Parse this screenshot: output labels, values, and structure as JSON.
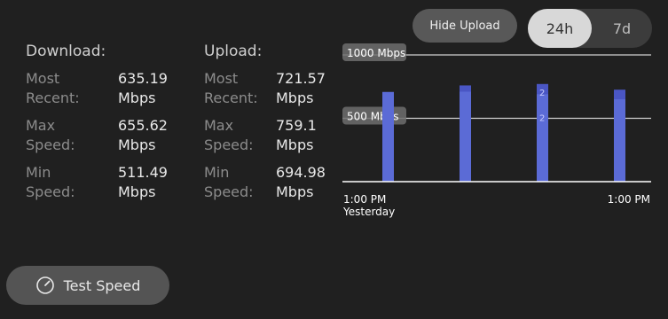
{
  "download": {
    "heading": "Download:",
    "rows": [
      {
        "label_1": "Most",
        "label_2": "Recent:",
        "value": "635.19",
        "unit": "Mbps"
      },
      {
        "label_1": "Max",
        "label_2": "Speed:",
        "value": "655.62",
        "unit": "Mbps"
      },
      {
        "label_1": "Min",
        "label_2": "Speed:",
        "value": "511.49",
        "unit": "Mbps"
      }
    ]
  },
  "upload": {
    "heading": "Upload:",
    "rows": [
      {
        "label_1": "Most",
        "label_2": "Recent:",
        "value": "721.57",
        "unit": "Mbps"
      },
      {
        "label_1": "Max",
        "label_2": "Speed:",
        "value": "759.1",
        "unit": "Mbps"
      },
      {
        "label_1": "Min",
        "label_2": "Speed:",
        "value": "694.98",
        "unit": "Mbps"
      }
    ]
  },
  "controls": {
    "hide_upload": "Hide Upload",
    "range_options": [
      "24h",
      "7d"
    ],
    "range_selected": "24h",
    "test_speed": "Test Speed"
  },
  "chart_data": {
    "type": "bar",
    "ytick_labels": [
      "1000 Mbps",
      "500 Mbps"
    ],
    "ylim": [
      0,
      1000
    ],
    "x_labels": {
      "start_line1": "1:00 PM",
      "start_line2": "Yesterday",
      "end": "1:00 PM"
    },
    "series": [
      {
        "name": "download",
        "values": [
          708,
          710,
          690,
          650
        ],
        "color": "#5b6bd6"
      },
      {
        "name": "upload",
        "values": [
          0,
          759,
          770,
          725
        ],
        "color": "#4a56c4"
      }
    ],
    "bar_labels": [
      "",
      "",
      "2",
      ""
    ],
    "bar_labels_2": [
      "",
      "",
      "2",
      ""
    ],
    "grid": true
  },
  "colors": {
    "bar": "#5b6bd6",
    "background": "#202020"
  }
}
